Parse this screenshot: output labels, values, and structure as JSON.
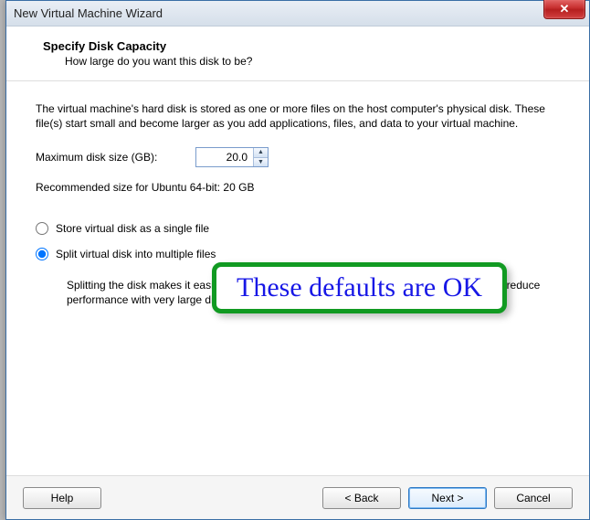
{
  "window": {
    "title": "New Virtual Machine Wizard"
  },
  "header": {
    "title": "Specify Disk Capacity",
    "subtitle": "How large do you want this disk to be?"
  },
  "body": {
    "description": "The virtual machine's hard disk is stored as one or more files on the host computer's physical disk. These file(s) start small and become larger as you add applications, files, and data to your virtual machine.",
    "disk_size_label": "Maximum disk size (GB):",
    "disk_size_value": "20.0",
    "recommended": "Recommended size for Ubuntu 64-bit: 20 GB",
    "radio_single": "Store virtual disk as a single file",
    "radio_split": "Split virtual disk into multiple files",
    "radio_selected": "split",
    "split_note": "Splitting the disk makes it easier to move the virtual machine to another computer but may reduce performance with very large disks."
  },
  "callout": {
    "text": "These defaults are OK"
  },
  "buttons": {
    "help": "Help",
    "back": "< Back",
    "next": "Next >",
    "cancel": "Cancel"
  }
}
